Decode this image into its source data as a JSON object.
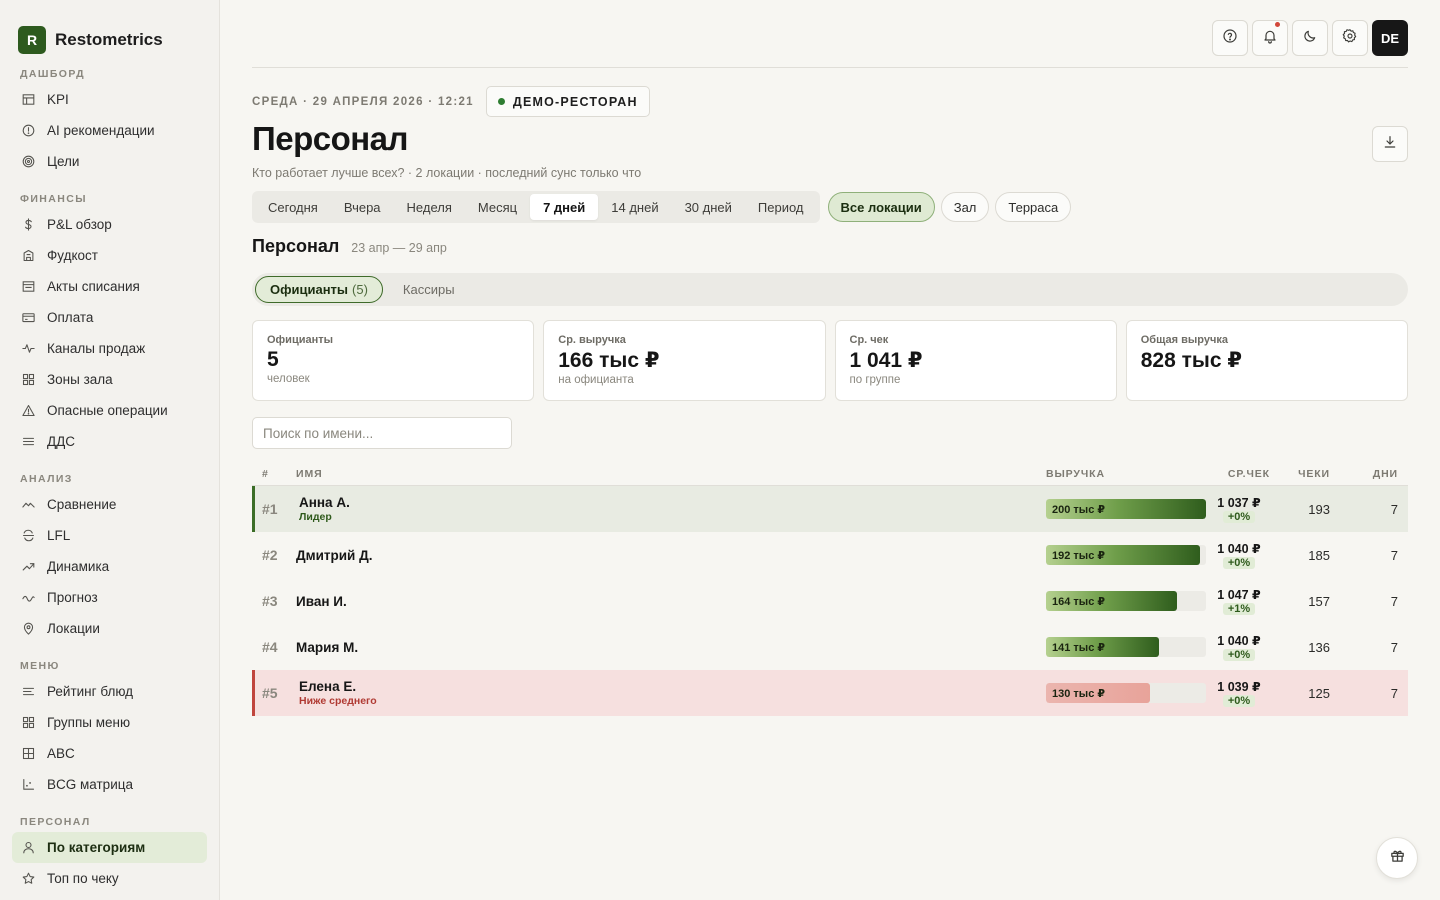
{
  "app": {
    "logo_letter": "R",
    "name": "Restometrics"
  },
  "sidebar": {
    "sections": [
      {
        "title": "ДАШБОРД",
        "items": [
          {
            "label": "KPI",
            "icon": "table-icon"
          },
          {
            "label": "AI рекомендации",
            "icon": "alert-circle-icon"
          },
          {
            "label": "Цели",
            "icon": "target-icon"
          }
        ]
      },
      {
        "title": "ФИНАНСЫ",
        "items": [
          {
            "label": "P&L обзор",
            "icon": "dollar-icon"
          },
          {
            "label": "Фудкост",
            "icon": "building-icon"
          },
          {
            "label": "Акты списания",
            "icon": "list-box-icon"
          },
          {
            "label": "Оплата",
            "icon": "card-icon"
          },
          {
            "label": "Каналы продаж",
            "icon": "pulse-icon"
          },
          {
            "label": "Зоны зала",
            "icon": "grid-icon"
          },
          {
            "label": "Опасные операции",
            "icon": "warning-icon"
          },
          {
            "label": "ДДС",
            "icon": "menu-lines-icon"
          }
        ]
      },
      {
        "title": "АНАЛИЗ",
        "items": [
          {
            "label": "Сравнение",
            "icon": "trend-icon"
          },
          {
            "label": "LFL",
            "icon": "lfl-icon"
          },
          {
            "label": "Динамика",
            "icon": "trending-up-icon"
          },
          {
            "label": "Прогноз",
            "icon": "wave-icon"
          },
          {
            "label": "Локации",
            "icon": "map-pin-icon"
          }
        ]
      },
      {
        "title": "МЕНЮ",
        "items": [
          {
            "label": "Рейтинг блюд",
            "icon": "align-left-icon"
          },
          {
            "label": "Группы меню",
            "icon": "grid-icon"
          },
          {
            "label": "ABC",
            "icon": "table-grid-icon"
          },
          {
            "label": "BCG матрица",
            "icon": "axis-chart-icon"
          }
        ]
      },
      {
        "title": "ПЕРСОНАЛ",
        "items": [
          {
            "label": "По категориям",
            "icon": "user-icon",
            "active": true
          },
          {
            "label": "Топ по чеку",
            "icon": "star-icon"
          }
        ]
      }
    ]
  },
  "topbar": {
    "avatar": "DE"
  },
  "header": {
    "date": "СРЕДА · 29 АПРЕЛЯ 2026 · 12:21",
    "restaurant": "ДЕМО-РЕСТОРАН",
    "title": "Персонал",
    "subtitle": "Кто работает лучше всех? · 2 локации · последний сунс только что"
  },
  "periods": [
    "Сегодня",
    "Вчера",
    "Неделя",
    "Месяц",
    "7 дней",
    "14 дней",
    "30 дней",
    "Период"
  ],
  "active_period": "7 дней",
  "locations": [
    "Все локации",
    "Зал",
    "Терраса"
  ],
  "active_location": "Все локации",
  "section": {
    "title": "Персонал",
    "range": "23 апр — 29 апр"
  },
  "tabs": [
    {
      "label": "Официанты",
      "count": "(5)",
      "active": true
    },
    {
      "label": "Кассиры",
      "count": "",
      "active": false
    }
  ],
  "kpis": [
    {
      "label": "Официанты",
      "value": "5",
      "sub": "человек"
    },
    {
      "label": "Ср. выручка",
      "value": "166 тыс ₽",
      "sub": "на официанта"
    },
    {
      "label": "Ср. чек",
      "value": "1 041 ₽",
      "sub": "по группе"
    },
    {
      "label": "Общая выручка",
      "value": "828 тыс ₽",
      "sub": ""
    }
  ],
  "search": {
    "placeholder": "Поиск по имени..."
  },
  "table": {
    "headers": {
      "rank": "#",
      "name": "ИМЯ",
      "revenue": "ВЫРУЧКА",
      "avg": "СР.ЧЕК",
      "checks": "ЧЕКИ",
      "days": "ДНИ"
    },
    "rows": [
      {
        "rank": "#1",
        "name": "Анна А.",
        "tag": "Лидер",
        "status": "top",
        "revenue": "200 тыс ₽",
        "revenue_share": 1.0,
        "avg": "1 037 ₽",
        "delta": "+0%",
        "checks": "193",
        "days": "7"
      },
      {
        "rank": "#2",
        "name": "Дмитрий Д.",
        "tag": "",
        "status": "normal",
        "revenue": "192 тыс ₽",
        "revenue_share": 0.96,
        "avg": "1 040 ₽",
        "delta": "+0%",
        "checks": "185",
        "days": "7"
      },
      {
        "rank": "#3",
        "name": "Иван И.",
        "tag": "",
        "status": "normal",
        "revenue": "164 тыс ₽",
        "revenue_share": 0.82,
        "avg": "1 047 ₽",
        "delta": "+1%",
        "checks": "157",
        "days": "7"
      },
      {
        "rank": "#4",
        "name": "Мария М.",
        "tag": "",
        "status": "normal",
        "revenue": "141 тыс ₽",
        "revenue_share": 0.705,
        "avg": "1 040 ₽",
        "delta": "+0%",
        "checks": "136",
        "days": "7"
      },
      {
        "rank": "#5",
        "name": "Елена Е.",
        "tag": "Ниже среднего",
        "status": "low",
        "revenue": "130 тыс ₽",
        "revenue_share": 0.65,
        "avg": "1 039 ₽",
        "delta": "+0%",
        "checks": "125",
        "days": "7"
      }
    ]
  },
  "colors": {
    "accent": "#2d5a1e",
    "top_row": "#e8ebe2",
    "low_row": "#f6e0df",
    "alert_dot": "#d2473a"
  }
}
